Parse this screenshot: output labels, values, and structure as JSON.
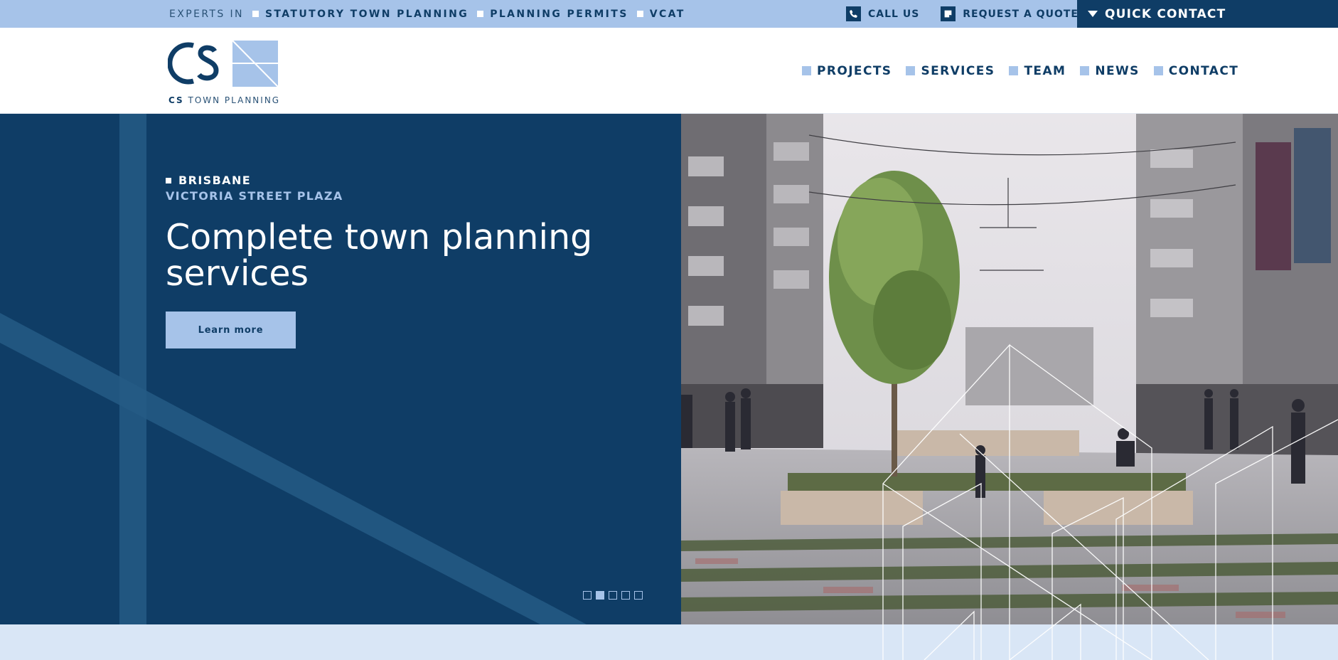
{
  "topbar": {
    "experts_label": "EXPERTS IN",
    "specialties": [
      "STATUTORY TOWN PLANNING",
      "PLANNING PERMITS",
      "VCAT"
    ],
    "call_label": "CALL US",
    "quote_label": "REQUEST A QUOTE",
    "quick_contact_label": "QUICK CONTACT"
  },
  "logo": {
    "bold": "CS",
    "rest": " TOWN PLANNING"
  },
  "nav": {
    "items": [
      "PROJECTS",
      "SERVICES",
      "TEAM",
      "NEWS",
      "CONTACT"
    ]
  },
  "hero": {
    "location": "BRISBANE",
    "project": "VICTORIA STREET PLAZA",
    "headline": "Complete town planning services",
    "cta_label": "Learn more",
    "slide_count": 5,
    "active_slide": 2
  },
  "colors": {
    "navy": "#0f3d66",
    "light_blue": "#a6c3e9",
    "pale_blue": "#d9e6f6"
  }
}
